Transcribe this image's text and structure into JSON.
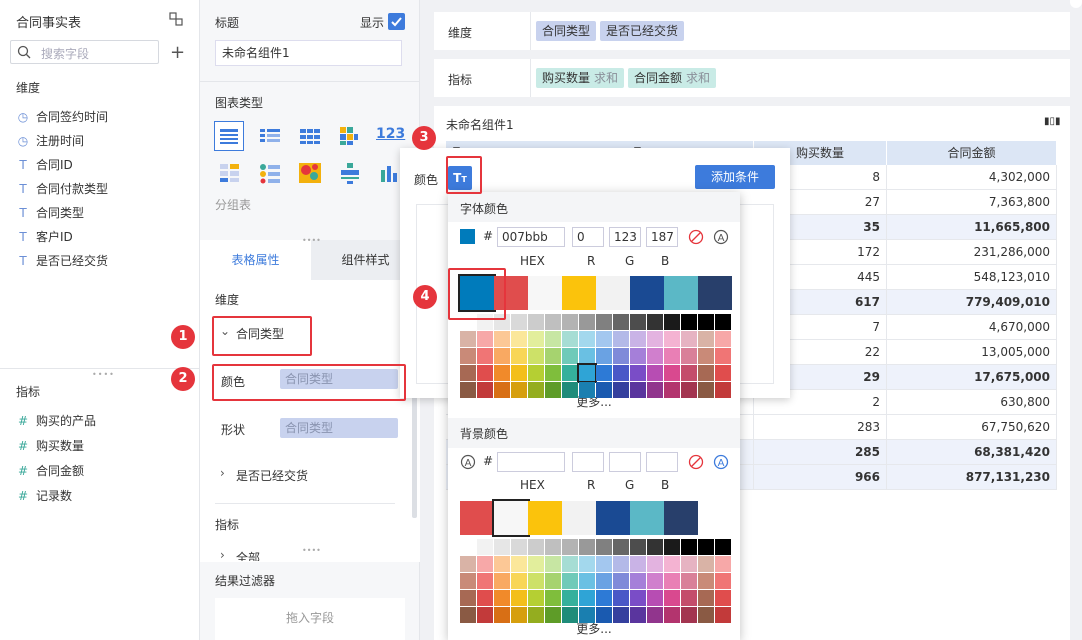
{
  "left_panel": {
    "dataset_title": "合同事实表",
    "search_placeholder": "搜索字段",
    "dimension_title": "维度",
    "dimension_fields": [
      {
        "icon": "clock-icon",
        "label": "合同签约时间"
      },
      {
        "icon": "clock-icon",
        "label": "注册时间"
      },
      {
        "icon": "text-type-icon",
        "label": "合同ID"
      },
      {
        "icon": "text-type-icon",
        "label": "合同付款类型"
      },
      {
        "icon": "text-type-icon",
        "label": "合同类型"
      },
      {
        "icon": "text-type-icon",
        "label": "客户ID"
      },
      {
        "icon": "text-type-icon",
        "label": "是否已经交货"
      }
    ],
    "measure_title": "指标",
    "measure_fields": [
      {
        "icon": "hash-icon",
        "label": "购买的产品"
      },
      {
        "icon": "hash-icon",
        "label": "购买数量"
      },
      {
        "icon": "hash-icon",
        "label": "合同金额"
      },
      {
        "icon": "hash-icon",
        "label": "记录数"
      }
    ]
  },
  "mid_panel": {
    "title_label": "标题",
    "show_label": "显示",
    "component_name": "未命名组件1",
    "chart_type_label": "图表类型",
    "group_table_label": "分组表",
    "tabs": [
      "表格属性",
      "组件样式"
    ],
    "dimension_label": "维度",
    "dim_group_1": "合同类型",
    "color_label": "颜色",
    "color_field": "合同类型",
    "shape_label": "形状",
    "shape_field": "合同类型",
    "dim_group_2": "是否已经交货",
    "measure_label": "指标",
    "measure_group": "全部",
    "filter_label": "结果过滤器",
    "drop_field": "拖入字段"
  },
  "right_panel": {
    "dimension_label": "维度",
    "dimension_pills": [
      "合同类型",
      "是否已经交货"
    ],
    "measure_label": "指标",
    "measure_pills": [
      {
        "name": "购买数量",
        "agg": "求和"
      },
      {
        "name": "合同金额",
        "agg": "求和"
      }
    ],
    "component_title": "未命名组件1",
    "table_headers": [
      "购买数量",
      "合同金额"
    ],
    "rows": [
      {
        "qty": "8",
        "amt": "4,302,000",
        "bold": false
      },
      {
        "qty": "27",
        "amt": "7,363,800",
        "bold": false
      },
      {
        "qty": "35",
        "amt": "11,665,800",
        "bold": true
      },
      {
        "qty": "172",
        "amt": "231,286,000",
        "bold": false
      },
      {
        "qty": "445",
        "amt": "548,123,010",
        "bold": false
      },
      {
        "qty": "617",
        "amt": "779,409,010",
        "bold": true
      },
      {
        "qty": "7",
        "amt": "4,670,000",
        "bold": false
      },
      {
        "qty": "22",
        "amt": "13,005,000",
        "bold": false
      },
      {
        "qty": "29",
        "amt": "17,675,000",
        "bold": true
      },
      {
        "qty": "2",
        "amt": "630,800",
        "bold": false
      },
      {
        "qty": "283",
        "amt": "67,750,620",
        "bold": false
      },
      {
        "qty": "285",
        "amt": "68,381,420",
        "bold": true
      },
      {
        "qty": "966",
        "amt": "877,131,230",
        "bold": true
      }
    ]
  },
  "color_popup": {
    "color_label": "颜色",
    "add_condition": "添加条件",
    "font_color_title": "字体颜色",
    "hex_value": "007bbb",
    "r_value": "0",
    "g_value": "123",
    "b_value": "187",
    "col_labels": [
      "HEX",
      "R",
      "G",
      "B"
    ],
    "more": "更多...",
    "bg_color_title": "背景颜色",
    "selected_color": "#007bbb"
  },
  "badges": [
    "1",
    "2",
    "3",
    "4"
  ]
}
